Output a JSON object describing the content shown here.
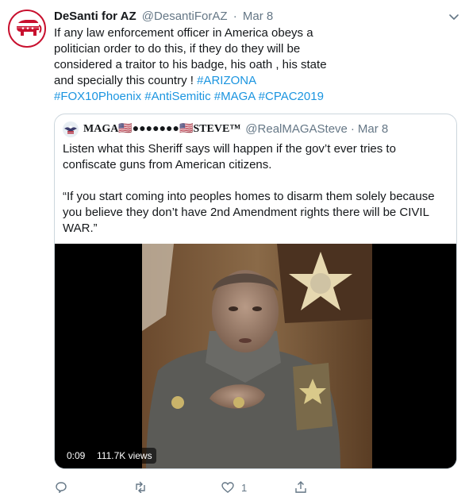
{
  "tweet": {
    "display_name": "DeSanti for AZ",
    "handle": "@DesantiForAZ",
    "separator": "·",
    "date": "Mar 8",
    "avatar_icon": "republican-elephant-icon",
    "body": "If any law enforcement officer in America obeys a politician order to do this, if they do they will be considered a traitor to his badge, his oath , his state and specially this country !",
    "hashtags": [
      "#ARIZONA",
      "#FOX10Phoenix",
      "#AntiSemitic",
      "#MAGA",
      "#CPAC2019"
    ]
  },
  "quoted_tweet": {
    "display_name": "MAGA🇺🇸●●●●●●●🇺🇸STEVE™",
    "handle": "@RealMAGASteve",
    "separator": "·",
    "date": "Mar 8",
    "paragraph_1": "Listen what this Sheriff says will happen if the gov’t ever tries to confiscate guns from American citizens.",
    "paragraph_2": "“If you start coming into peoples homes to disarm them solely because you believe they don’t have 2nd Amendment rights there will be CIVIL WAR.”",
    "video": {
      "duration": "0:09",
      "views": "111.7K views"
    }
  },
  "actions": {
    "reply_icon": "reply-icon",
    "retweet_icon": "retweet-icon",
    "like_icon": "heart-icon",
    "like_count": "1",
    "share_icon": "share-icon"
  },
  "colors": {
    "link": "#1b95e0",
    "muted": "#657786",
    "text": "#14171a",
    "border": "#ccd6dd",
    "brand_red": "#c8102e"
  }
}
